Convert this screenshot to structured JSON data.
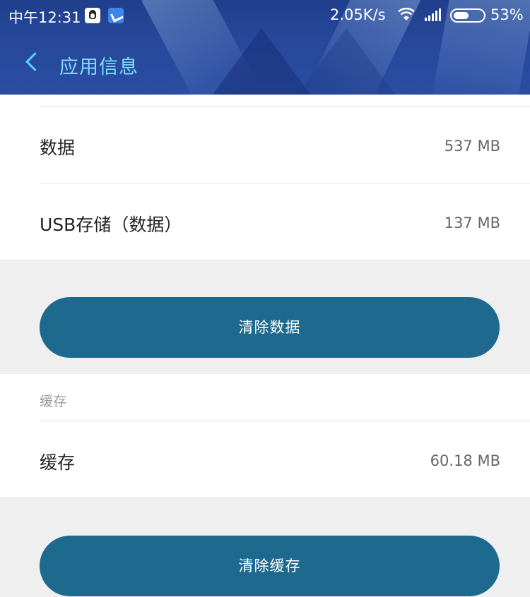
{
  "status_bar": {
    "time": "中午12:31",
    "net_speed": "2.05K/s",
    "battery_percent": "53%",
    "battery_level": 0.53,
    "notification_icons": [
      "qq-icon",
      "bird-icon"
    ]
  },
  "nav": {
    "title": "应用信息",
    "back_icon": "chevron-left-icon"
  },
  "storage": {
    "rows": [
      {
        "label": "数据",
        "value": "537 MB"
      },
      {
        "label": "USB存储（数据）",
        "value": "137 MB"
      }
    ],
    "clear_data_label": "清除数据"
  },
  "cache": {
    "section_title": "缓存",
    "row": {
      "label": "缓存",
      "value": "60.18 MB"
    },
    "clear_cache_label": "清除缓存"
  },
  "colors": {
    "header_bg": "#27489b",
    "title_accent": "#7fdcff",
    "button_bg": "#1e6a8e",
    "page_bg": "#efefef"
  }
}
